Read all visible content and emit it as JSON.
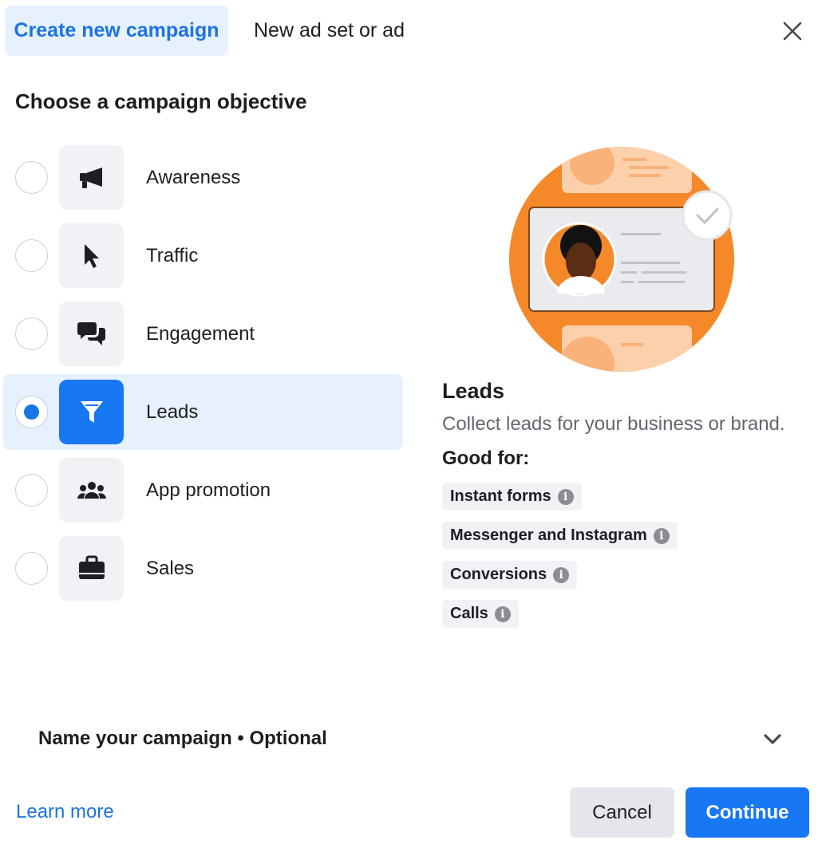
{
  "tabs": {
    "active": "Create new campaign",
    "other": "New ad set or ad"
  },
  "heading": "Choose a campaign objective",
  "objectives": [
    {
      "label": "Awareness",
      "icon": "megaphone-icon",
      "selected": false
    },
    {
      "label": "Traffic",
      "icon": "cursor-icon",
      "selected": false
    },
    {
      "label": "Engagement",
      "icon": "chat-bubbles-icon",
      "selected": false
    },
    {
      "label": "Leads",
      "icon": "funnel-icon",
      "selected": true
    },
    {
      "label": "App promotion",
      "icon": "people-group-icon",
      "selected": false
    },
    {
      "label": "Sales",
      "icon": "shopping-bag-icon",
      "selected": false
    }
  ],
  "detail": {
    "title": "Leads",
    "description": "Collect leads for your business or brand.",
    "good_for_label": "Good for:",
    "good_for": [
      "Instant forms",
      "Messenger and Instagram",
      "Conversions",
      "Calls"
    ]
  },
  "footer": {
    "name_campaign": "Name your campaign • Optional",
    "learn_more": "Learn more",
    "cancel": "Cancel",
    "continue": "Continue"
  },
  "colors": {
    "accent": "#1877f2",
    "selected_bg": "#e7f0fd",
    "illustration_orange": "#f5892a"
  }
}
